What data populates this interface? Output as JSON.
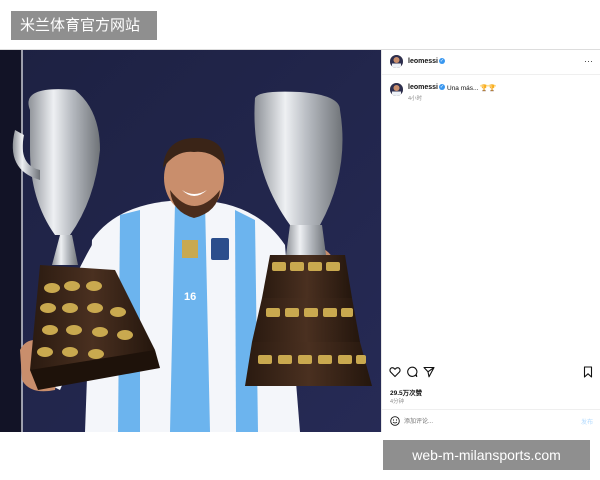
{
  "watermark_top": "米兰体育官方网站",
  "watermark_bottom": "web-m-milansports.com",
  "post": {
    "username": "leomessi",
    "caption_username": "leomessi",
    "caption_text": "Una más... 🏆🏆",
    "caption_time": "4小时",
    "more_label": "···",
    "likes": "29.5万次赞",
    "time_ago": "4分钟",
    "comment_placeholder": "添加评论...",
    "post_button": "发布",
    "jersey_number": "16"
  },
  "icons": [
    "heart-icon",
    "comment-icon",
    "share-icon",
    "bookmark-icon",
    "emoji-icon",
    "verified-badge-icon",
    "more-icon"
  ],
  "colors": {
    "verified": "#3897f0",
    "watermark_bg": "#8f8f8f",
    "photo_bg": "#1c1e3c",
    "jersey_blue": "#6cb4ee",
    "trophy_silver": "#c9ccd1",
    "trophy_base": "#3b2618",
    "plaque_gold": "#c9a94f"
  }
}
